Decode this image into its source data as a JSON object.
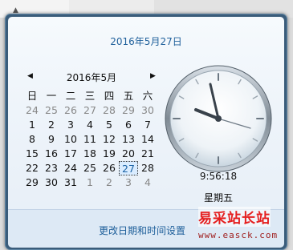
{
  "header": {
    "date_link": "2016年5月27日"
  },
  "calendar": {
    "prev_icon": "triangle-left-icon",
    "next_icon": "triangle-right-icon",
    "month_title": "2016年5月",
    "weekdays": [
      "日",
      "一",
      "二",
      "三",
      "四",
      "五",
      "六"
    ],
    "weeks": [
      [
        "24",
        "25",
        "26",
        "27",
        "28",
        "29",
        "30"
      ],
      [
        "1",
        "2",
        "3",
        "4",
        "5",
        "6",
        "7"
      ],
      [
        "8",
        "9",
        "10",
        "11",
        "12",
        "13",
        "14"
      ],
      [
        "15",
        "16",
        "17",
        "18",
        "19",
        "20",
        "21"
      ],
      [
        "22",
        "23",
        "24",
        "25",
        "26",
        "27",
        "28"
      ],
      [
        "29",
        "30",
        "31",
        "1",
        "2",
        "3",
        "4"
      ]
    ],
    "today": "27"
  },
  "clock": {
    "time": "9:56:18",
    "day": "星期五"
  },
  "footer": {
    "settings_link": "更改日期和时间设置"
  },
  "watermark": {
    "text": "易采站长站",
    "url": "www.easck.com"
  }
}
